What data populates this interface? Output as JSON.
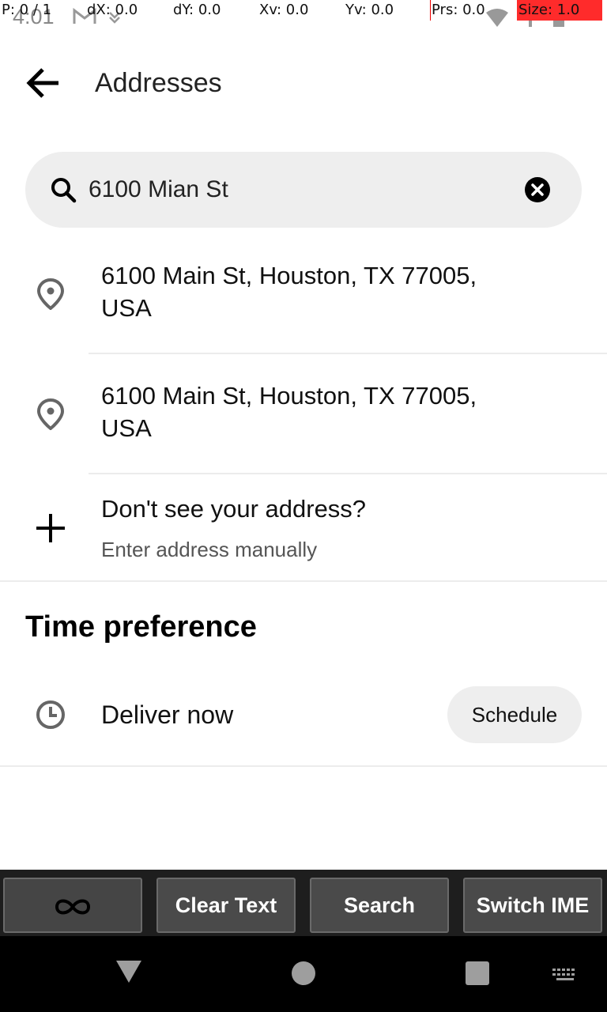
{
  "status_bar": {
    "time": "4:01",
    "left_icons": [
      "gmail-icon",
      "download-icon"
    ],
    "right_icons": [
      "wifi-icon",
      "signal-icon",
      "battery-icon"
    ]
  },
  "pointer_overlay": {
    "p": "P: 0 / 1",
    "dx": "dX: 0.0",
    "dy": "dY: 0.0",
    "xv": "Xv: 0.0",
    "yv": "Yv: 0.0",
    "prs": "Prs: 0.0",
    "size": "Size: 1.0",
    "size_color": "#ff2b2b"
  },
  "header": {
    "back_icon": "arrow-left-icon",
    "title": "Addresses"
  },
  "search": {
    "value": "6100 Mian St",
    "icon": "search-icon",
    "clear_icon": "close-icon"
  },
  "results": [
    {
      "line1": "6100 Main St, Houston, TX 77005,",
      "line2": "USA",
      "icon": "location-pin-icon"
    },
    {
      "line1": "6100 Main St, Houston, TX 77005,",
      "line2": "USA",
      "icon": "location-pin-icon"
    }
  ],
  "manual_entry": {
    "title": "Don't see your address?",
    "subtitle": "Enter address manually",
    "icon": "plus-icon"
  },
  "time_preference": {
    "title": "Time preference",
    "option": "Deliver now",
    "schedule_label": "Schedule",
    "icon": "clock-icon"
  },
  "ime_toolbar": {
    "buttons": [
      "",
      "Clear Text",
      "Search",
      "Switch IME"
    ],
    "first_icon": "infinity-icon"
  },
  "nav_bar": {
    "icons": [
      "back-triangle-icon",
      "home-circle-icon",
      "recents-square-icon",
      "keyboard-icon"
    ]
  }
}
